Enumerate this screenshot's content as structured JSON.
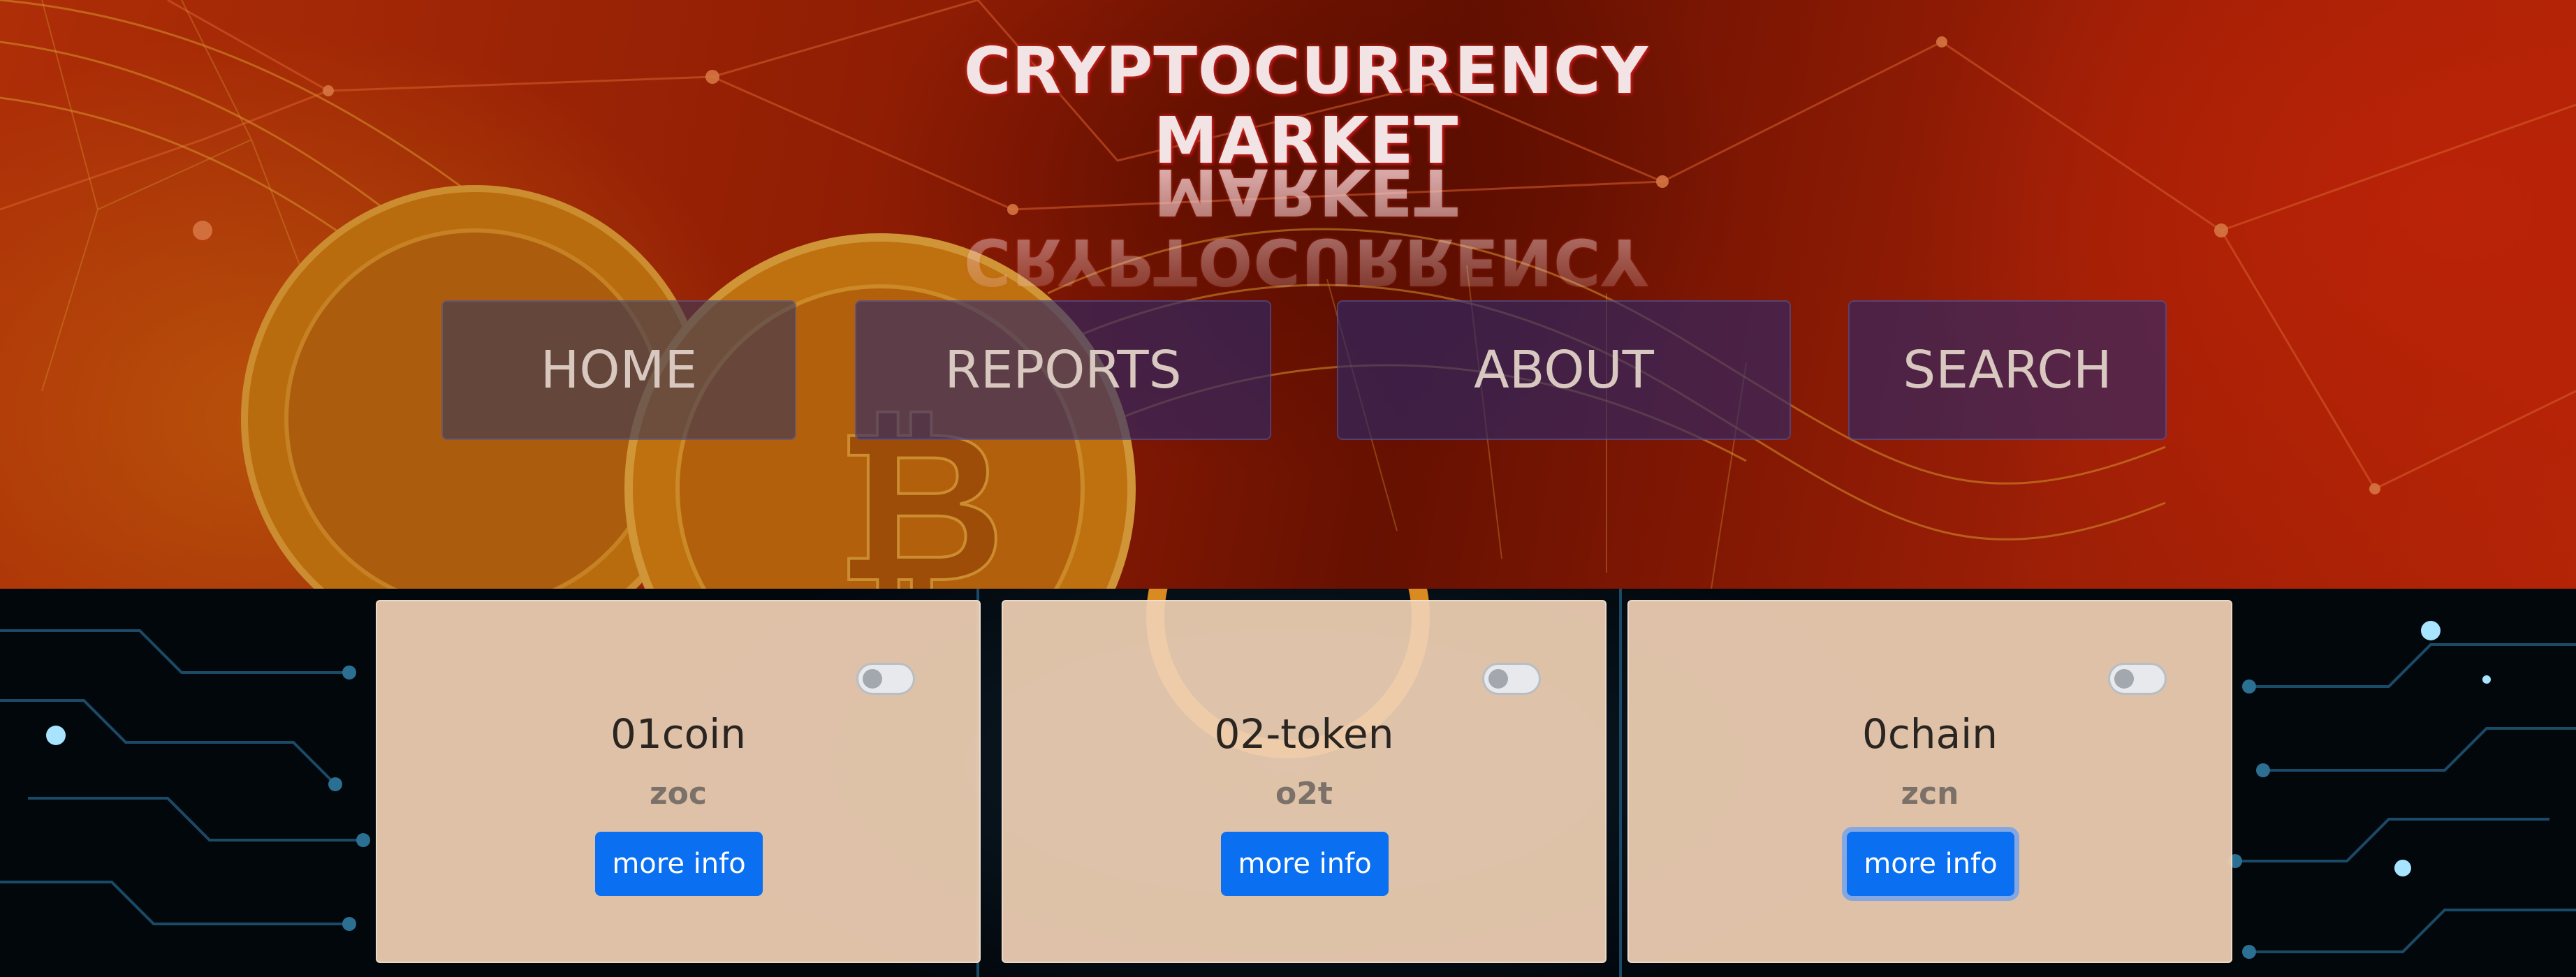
{
  "header": {
    "title": "CRYPTOCURRENCY MARKET"
  },
  "nav": {
    "home": "HOME",
    "reports": "REPORTS",
    "about": "ABOUT",
    "search": "SEARCH"
  },
  "cards": [
    {
      "name": "01coin",
      "symbol": "zoc",
      "button_label": "more info",
      "toggle_on": false
    },
    {
      "name": "02-token",
      "symbol": "o2t",
      "button_label": "more info",
      "toggle_on": false
    },
    {
      "name": "0chain",
      "symbol": "zcn",
      "button_label": "more info",
      "toggle_on": false
    }
  ],
  "colors": {
    "button_blue": "#0a6ff0",
    "card_bg": "#efd0b4",
    "nav_bg": "#28286e"
  }
}
